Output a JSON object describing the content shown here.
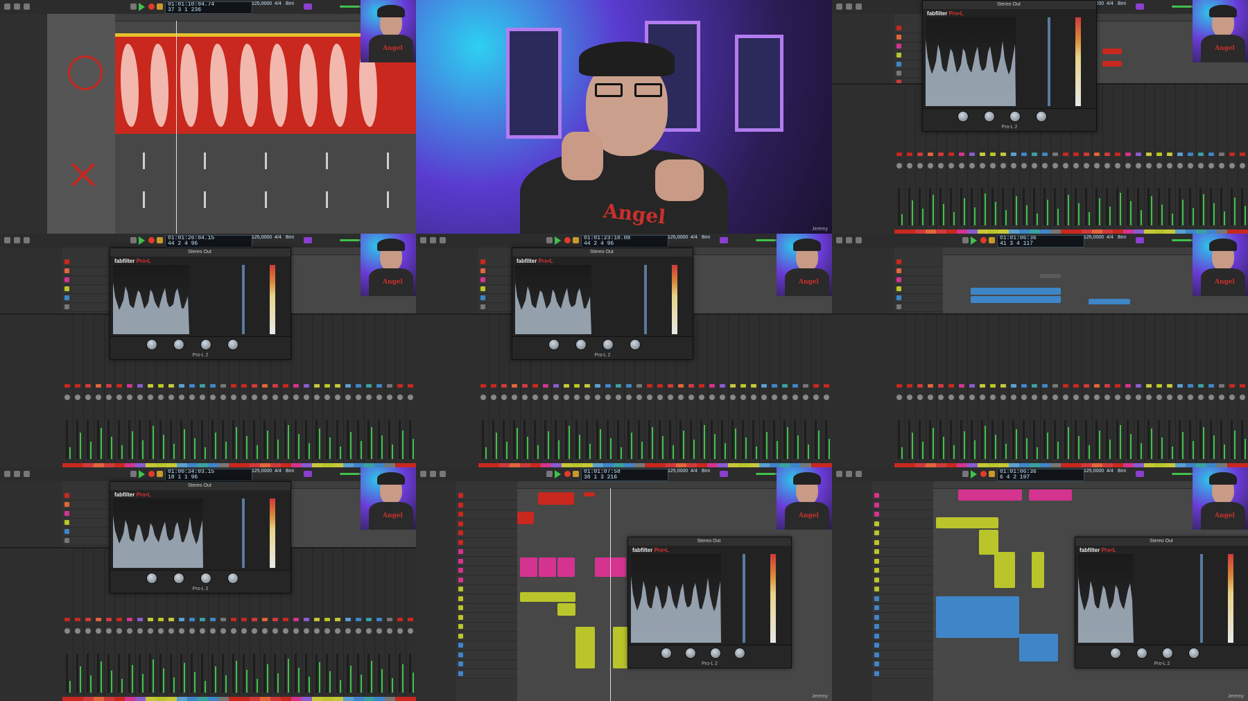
{
  "app": {
    "lcd_rows": [
      {
        "time": "01:01:10:04.74",
        "bars": "37 3 1 236",
        "tempo": "125,0000",
        "sig": "4/4",
        "key": "Bmi"
      },
      {
        "time": "01:01:26:04.15",
        "bars": "44 2 4 96",
        "tempo": "125,0000",
        "sig": "4/4",
        "key": "Bmi"
      },
      {
        "time": "01:01:23:10.08",
        "bars": "44 2 4 96",
        "tempo": "125,0000",
        "sig": "4/4",
        "key": "Bmi"
      },
      {
        "time": "01:01:06:36",
        "bars": "41 3 4 117",
        "tempo": "125,0000",
        "sig": "4/4",
        "key": "Bmi"
      },
      {
        "time": "01:00:34:03.15",
        "bars": "18 1 1 96",
        "tempo": "125,0000",
        "sig": "4/4",
        "key": "Bmi"
      },
      {
        "time": "01:01:07:58",
        "bars": "38 1 3 216",
        "tempo": "125,0000",
        "sig": "4/4",
        "key": "Bmi"
      },
      {
        "time": "01:01:06:36",
        "bars": "6 4 2 197",
        "tempo": "125,0000",
        "sig": "4/4",
        "key": "Bmi"
      }
    ]
  },
  "plugin": {
    "brand": "fabfilter",
    "product": "Pro•L",
    "title": "Pro-L 2",
    "header_label": "Stereo Out"
  },
  "webcam": {
    "shirt_text": "Angel"
  },
  "watermark": "Jeremy",
  "colors": {
    "accent_red": "#c8281e",
    "region_pink": "#d4338f",
    "region_yellow": "#b9c52a",
    "region_blue": "#3e86c8",
    "play_green": "#3fc24a",
    "studio_purple": "#5a3bd0"
  }
}
